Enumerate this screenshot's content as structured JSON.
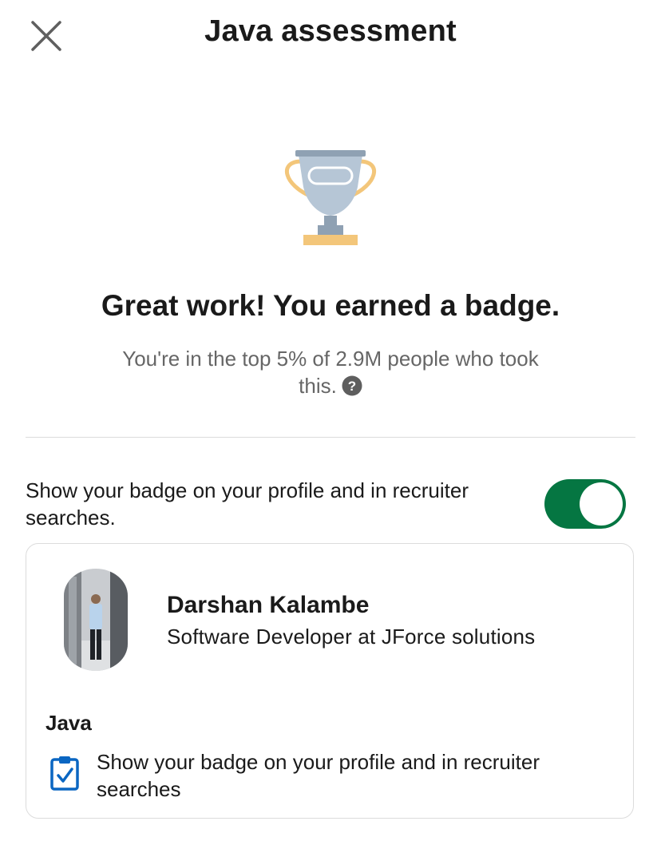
{
  "header": {
    "title": "Java assessment",
    "close_icon": "close-icon"
  },
  "result": {
    "icon": "trophy-icon",
    "headline": "Great work! You earned a badge.",
    "subtext": "You're in the top 5% of 2.9M people who took this.",
    "help_icon": "question-circle-icon"
  },
  "setting": {
    "label": "Show your badge on your profile and in recruiter searches.",
    "toggle_on": true,
    "toggle_color": "#057642"
  },
  "preview_card": {
    "name": "Darshan Kalambe",
    "headline": "Software Developer at JForce solutions",
    "skill": "Java",
    "badge_icon": "clipboard-check-icon",
    "badge_text": "Show your badge on your profile and in recruiter searches"
  }
}
